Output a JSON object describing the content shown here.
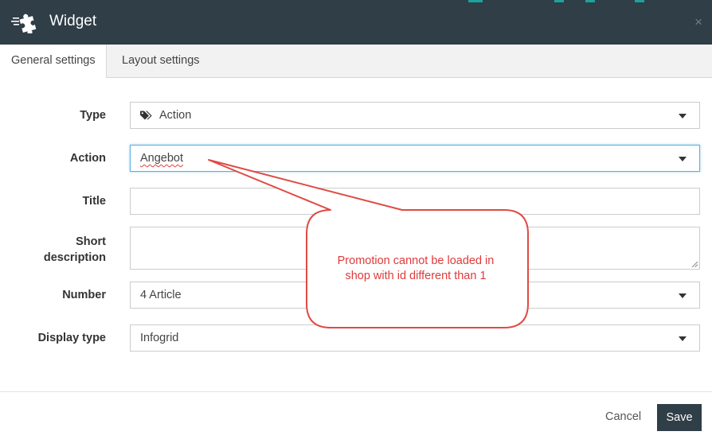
{
  "dialog": {
    "title": "Widget",
    "close_glyph": "×",
    "logo_icon": "puzzle-piece-icon"
  },
  "tabs": [
    {
      "label": "General settings",
      "active": true
    },
    {
      "label": "Layout settings",
      "active": false
    }
  ],
  "form": {
    "type": {
      "label": "Type",
      "value": "Action",
      "icon": "tags-icon"
    },
    "action": {
      "label": "Action",
      "value": "Angebot"
    },
    "title": {
      "label": "Title",
      "value": ""
    },
    "short_description": {
      "label_line1": "Short",
      "label_line2": "description",
      "value": ""
    },
    "number": {
      "label": "Number",
      "value": "4 Article"
    },
    "display_type": {
      "label": "Display type",
      "value": "Infogrid"
    }
  },
  "footer": {
    "cancel_label": "Cancel",
    "save_label": "Save"
  },
  "annotation": {
    "line1": "Promotion cannot be loaded in",
    "line2": "shop with id different than 1",
    "color": "#e03a3a"
  },
  "colors": {
    "header_bg": "#2f3e47",
    "accent": "#1ba39c",
    "focus_border": "#5ab0e0"
  }
}
